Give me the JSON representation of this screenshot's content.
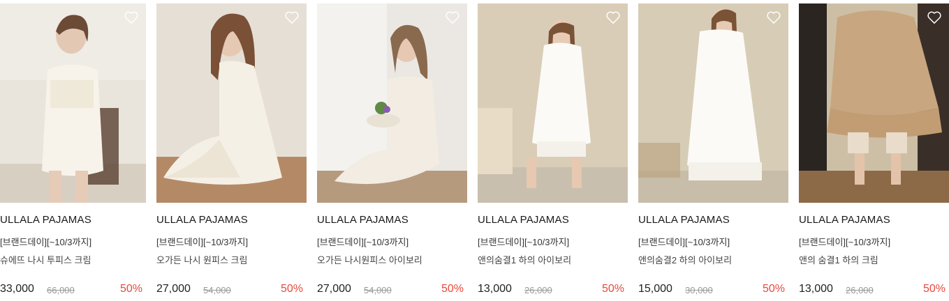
{
  "products": [
    {
      "brand": "ULLALA PAJAMAS",
      "promo": "[브랜드데이][~10/3까지]",
      "name": "슈에뜨 나시 투피스 크림",
      "price": "33,000",
      "original_price": "66,000",
      "discount": "50%"
    },
    {
      "brand": "ULLALA PAJAMAS",
      "promo": "[브랜드데이][~10/3까지]",
      "name": "오가든 나시 원피스 크림",
      "price": "27,000",
      "original_price": "54,000",
      "discount": "50%"
    },
    {
      "brand": "ULLALA PAJAMAS",
      "promo": "[브랜드데이][~10/3까지]",
      "name": "오가든 나시원피스 아이보리",
      "price": "27,000",
      "original_price": "54,000",
      "discount": "50%"
    },
    {
      "brand": "ULLALA PAJAMAS",
      "promo": "[브랜드데이][~10/3까지]",
      "name": "앤의숨결1 하의 아이보리",
      "price": "13,000",
      "original_price": "26,000",
      "discount": "50%"
    },
    {
      "brand": "ULLALA PAJAMAS",
      "promo": "[브랜드데이][~10/3까지]",
      "name": "앤의숨결2 하의 아이보리",
      "price": "15,000",
      "original_price": "30,000",
      "discount": "50%"
    },
    {
      "brand": "ULLALA PAJAMAS",
      "promo": "[브랜드데이][~10/3까지]",
      "name": "앤의 숨결1 하의 크림",
      "price": "13,000",
      "original_price": "26,000",
      "discount": "50%"
    }
  ],
  "icons": {
    "wishlist": "heart-outline-icon"
  },
  "colors": {
    "discount": "#e8493c",
    "original_price": "#999999"
  }
}
